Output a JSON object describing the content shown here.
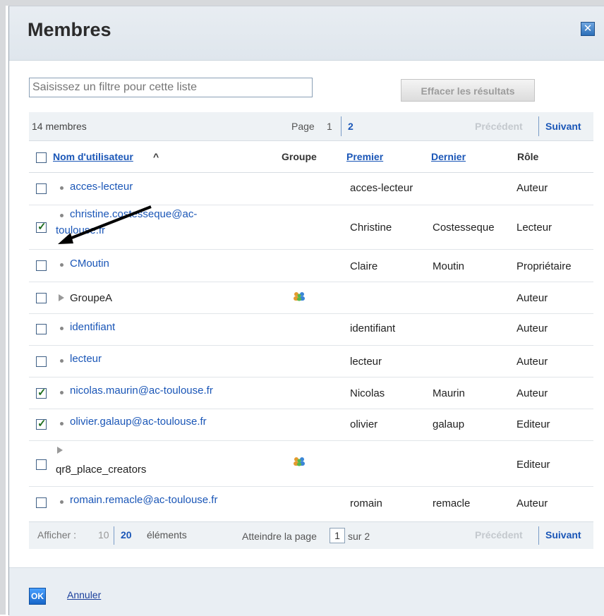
{
  "dialog": {
    "title": "Membres",
    "close_icon": "close-icon",
    "filter_placeholder": "Saisissez un filtre pour cette liste",
    "clear_button": "Effacer les résultats"
  },
  "pager_top": {
    "count": "14 membres",
    "page_label": "Page",
    "page_current": "1",
    "page_next": "2",
    "prev": "Précédent",
    "next": "Suivant"
  },
  "columns": {
    "username": "Nom d'utilisateur",
    "sort_indicator": "^",
    "group": "Groupe",
    "first": "Premier",
    "last": "Dernier",
    "role": "Rôle"
  },
  "rows": [
    {
      "name": "acces-lecteur",
      "type": "user",
      "checked": false,
      "first": "acces-lecteur",
      "last": "",
      "role": "Auteur"
    },
    {
      "name_line1": "christine.costesseque@ac-",
      "name_line2": "toulouse.fr",
      "type": "user",
      "checked": true,
      "first": "Christine",
      "last": "Costesseque",
      "role": "Lecteur"
    },
    {
      "name": "CMoutin",
      "type": "user",
      "checked": false,
      "first": "Claire",
      "last": "Moutin",
      "role": "Propriétaire"
    },
    {
      "name": "GroupeA",
      "type": "group",
      "checked": false,
      "first": "",
      "last": "",
      "role": "Auteur"
    },
    {
      "name": "identifiant",
      "type": "user",
      "checked": false,
      "first": "identifiant",
      "last": "",
      "role": "Auteur"
    },
    {
      "name": "lecteur",
      "type": "user",
      "checked": false,
      "first": "lecteur",
      "last": "",
      "role": "Auteur"
    },
    {
      "name": "nicolas.maurin@ac-toulouse.fr",
      "type": "user",
      "checked": true,
      "first": "Nicolas",
      "last": "Maurin",
      "role": "Auteur"
    },
    {
      "name": "olivier.galaup@ac-toulouse.fr",
      "type": "user",
      "checked": true,
      "first": "olivier",
      "last": "galaup",
      "role": "Editeur"
    },
    {
      "name": "qr8_place_creators",
      "type": "group",
      "checked": false,
      "first": "",
      "last": "",
      "role": "Editeur"
    },
    {
      "name": "romain.remacle@ac-toulouse.fr",
      "type": "user",
      "checked": false,
      "first": "romain",
      "last": "remacle",
      "role": "Auteur"
    }
  ],
  "pager_bottom": {
    "show_label": "Afficher :",
    "opt_10": "10",
    "opt_20": "20",
    "elements": "éléments",
    "goto_label": "Atteindre la page",
    "goto_value": "1",
    "of_label": "sur 2",
    "prev": "Précédent",
    "next": "Suivant"
  },
  "footer": {
    "ok": "OK",
    "cancel": "Annuler"
  },
  "colors": {
    "link": "#1a56b7",
    "header_bg": "#e8edf2"
  }
}
